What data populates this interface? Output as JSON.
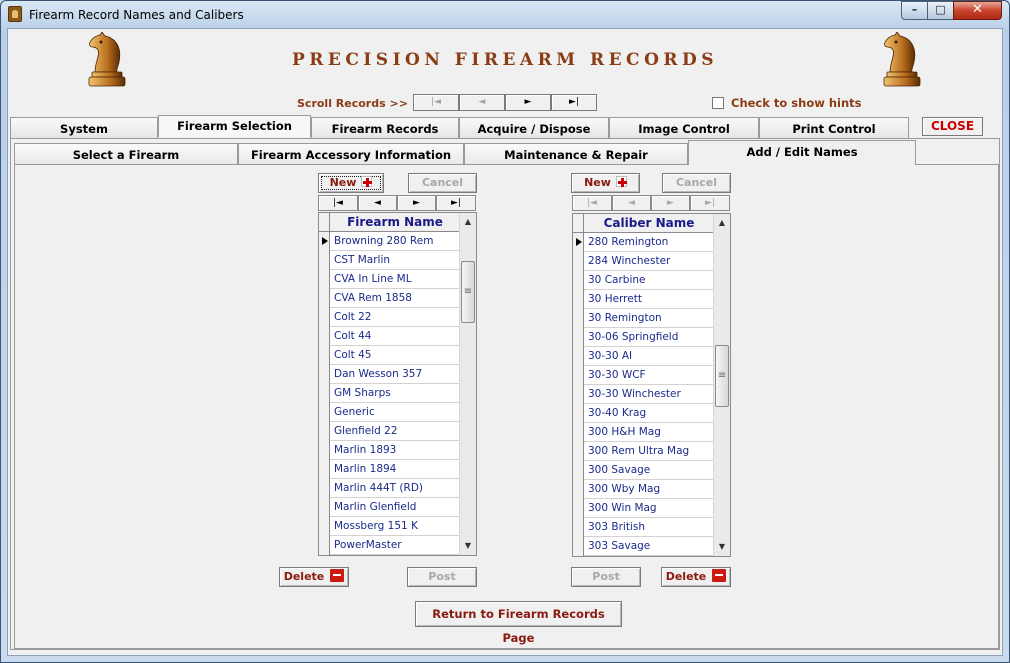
{
  "window": {
    "title": "Firearm Record Names and Calibers",
    "buttons": {
      "minimize": "–",
      "maximize": "□",
      "close": "✕"
    }
  },
  "header": {
    "brand_title": "PRECISION FIREARM RECORDS",
    "logo_icon": "knight-chess-piece"
  },
  "scroll": {
    "label": "Scroll  Records >>",
    "first": "|◄",
    "prev": "◄",
    "next": "►",
    "last": "►|",
    "hints_label": "Check to show hints",
    "hints_checked": false
  },
  "tabs": [
    {
      "label": "System"
    },
    {
      "label": "Firearm Selection",
      "active": true
    },
    {
      "label": "Firearm Records"
    },
    {
      "label": "Acquire / Dispose"
    },
    {
      "label": "Image Control"
    },
    {
      "label": "Print Control"
    }
  ],
  "close_label": "CLOSE",
  "subtabs": [
    {
      "label": "Select a Firearm"
    },
    {
      "label": "Firearm Accessory Information"
    },
    {
      "label": "Maintenance & Repair"
    },
    {
      "label": "Add / Edit Names",
      "active": true
    }
  ],
  "firearms": {
    "new_label": "New",
    "cancel_label": "Cancel",
    "nav": {
      "first": "|◄",
      "prev": "◄",
      "next": "►",
      "last": "►|"
    },
    "column_header": "Firearm Name",
    "rows": [
      "Browning 280 Rem",
      "CST Marlin",
      "CVA In Line ML",
      "CVA Rem 1858",
      "Colt 22",
      "Colt 44",
      "Colt 45",
      "Dan Wesson 357",
      "GM Sharps",
      "Generic",
      "Glenfield 22",
      "Marlin 1893",
      "Marlin 1894",
      "Marlin 444T (RD)",
      "Marlin Glenfield",
      "Mossberg 151 K",
      "PowerMaster"
    ],
    "current_row": 0,
    "scroll_position": 0.1,
    "delete_label": "Delete",
    "post_label": "Post"
  },
  "calibers": {
    "new_label": "New",
    "cancel_label": "Cancel",
    "nav": {
      "first": "|◄",
      "prev": "◄",
      "next": "►",
      "last": "►|"
    },
    "column_header": "Caliber Name",
    "rows": [
      "280 Remington",
      "284 Winchester",
      "30 Carbine",
      "30 Herrett",
      "30 Remington",
      "30-06 Springfield",
      "30-30 AI",
      "30-30 WCF",
      "30-30 Winchester",
      "30-40 Krag",
      "300 H&H Mag",
      "300 Rem Ultra Mag",
      "300 Savage",
      "300 Wby Mag",
      "300 Win Mag",
      "303 British",
      "303 Savage"
    ],
    "current_row": 0,
    "scroll_position": 0.45,
    "delete_label": "Delete",
    "post_label": "Post"
  },
  "return_label": "Return to Firearm Records Page"
}
